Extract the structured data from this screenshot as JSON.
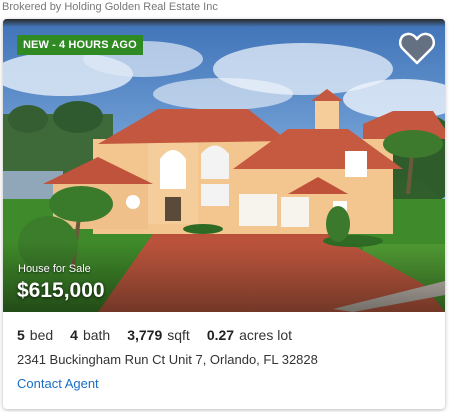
{
  "broker": "Brokered by Holding Golden Real Estate Inc",
  "listing": {
    "badge": "NEW - 4 HOURS AGO",
    "favorite_icon": "heart-icon",
    "sale_type": "House for Sale",
    "price": "$615,000",
    "beds": {
      "value": "5",
      "unit": "bed"
    },
    "baths": {
      "value": "4",
      "unit": "bath"
    },
    "sqft": {
      "value": "3,779",
      "unit": "sqft"
    },
    "lot": {
      "value": "0.27",
      "unit": "acres lot"
    },
    "address": "2341 Buckingham Run Ct Unit 7, Orlando, FL 32828",
    "contact_label": "Contact Agent"
  },
  "colors": {
    "badge_bg": "#2f8a24",
    "link": "#1a6fc4",
    "sky": "#6f9fd6",
    "roof": "#c4573f",
    "wall": "#f2c68e",
    "driveway": "#c85a40",
    "lawn": "#3f8a2a"
  }
}
